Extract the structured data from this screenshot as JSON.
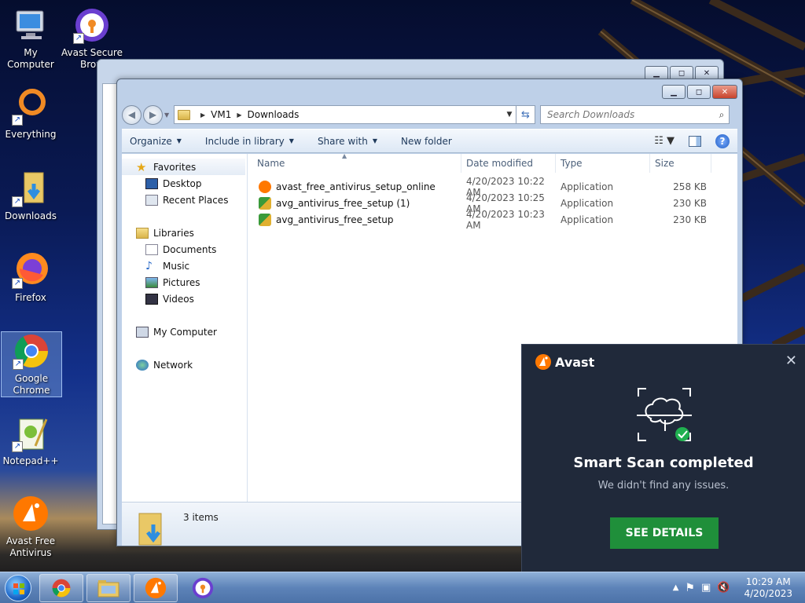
{
  "desktop": {
    "icons": [
      {
        "label": "My Computer",
        "icon": "computer-icon"
      },
      {
        "label": "Avast Secure Brow",
        "icon": "avast-secure-browser-icon"
      },
      {
        "label": "Everything",
        "icon": "everything-search-icon"
      },
      {
        "label": "Downloads",
        "icon": "downloads-folder-icon"
      },
      {
        "label": "Firefox",
        "icon": "firefox-icon"
      },
      {
        "label": "Google Chrome",
        "icon": "chrome-icon"
      },
      {
        "label": "Notepad++",
        "icon": "notepad-plus-plus-icon"
      },
      {
        "label": "Avast Free Antivirus",
        "icon": "avast-antivirus-icon"
      }
    ]
  },
  "explorer": {
    "breadcrumb": [
      "VM1",
      "Downloads"
    ],
    "search_placeholder": "Search Downloads",
    "toolbar": {
      "organize": "Organize",
      "include_in_library": "Include in library",
      "share_with": "Share with",
      "new_folder": "New folder"
    },
    "nav": {
      "favorites": "Favorites",
      "desktop": "Desktop",
      "recent_places": "Recent Places",
      "libraries": "Libraries",
      "documents": "Documents",
      "music": "Music",
      "pictures": "Pictures",
      "videos": "Videos",
      "my_computer": "My Computer",
      "network": "Network"
    },
    "columns": {
      "name": "Name",
      "date_modified": "Date modified",
      "type": "Type",
      "size": "Size"
    },
    "files": [
      {
        "name": "avast_free_antivirus_setup_online",
        "date": "4/20/2023 10:22 AM",
        "type": "Application",
        "size": "258 KB",
        "icon": "avast-installer-icon"
      },
      {
        "name": "avg_antivirus_free_setup (1)",
        "date": "4/20/2023 10:25 AM",
        "type": "Application",
        "size": "230 KB",
        "icon": "avg-installer-icon"
      },
      {
        "name": "avg_antivirus_free_setup",
        "date": "4/20/2023 10:23 AM",
        "type": "Application",
        "size": "230 KB",
        "icon": "avg-installer-icon"
      }
    ],
    "item_count": "3 items"
  },
  "avast_popup": {
    "brand": "Avast",
    "headline": "Smart Scan completed",
    "message": "We didn't find any issues.",
    "button": "SEE DETAILS",
    "accent": "#1f8f3a",
    "brand_color": "#ff7800"
  },
  "taskbar": {
    "apps": [
      "chrome-icon",
      "explorer-folder-icon",
      "avast-antivirus-icon",
      "avast-secure-browser-icon"
    ],
    "clock_time": "10:29 AM",
    "clock_date": "4/20/2023"
  }
}
